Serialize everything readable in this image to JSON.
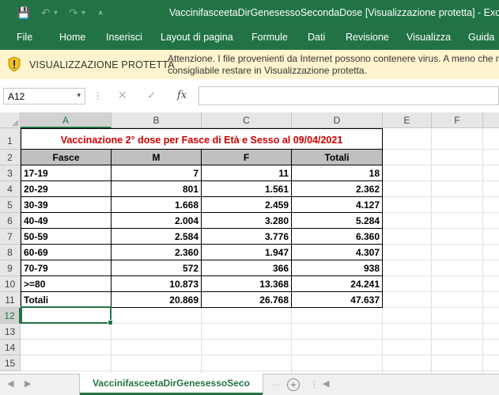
{
  "window": {
    "title": "VaccinifasceetaDirGenesessoSecondaDose  [Visualizzazione protetta]  -  Excel",
    "qat": {
      "save": "💾",
      "undo": "↶",
      "undo_dd": "▾",
      "redo": "↷",
      "redo_dd": "▾",
      "customize": "⩡"
    }
  },
  "ribbon": {
    "tabs": [
      "File",
      "Home",
      "Inserisci",
      "Layout di pagina",
      "Formule",
      "Dati",
      "Revisione",
      "Visualizza",
      "Guida"
    ]
  },
  "message_bar": {
    "title": "VISUALIZZAZIONE PROTETTA",
    "line1": "Attenzione. I file provenienti da Internet possono contenere virus. A meno che n",
    "line2": "consigliabile restare in Visualizzazione protetta.",
    "accent": "#f1c21b"
  },
  "formula_bar": {
    "name_box": "A12",
    "name_dd": "▾",
    "sep": "⋮",
    "cancel": "✕",
    "enter": "✓",
    "fx": "fx",
    "formula": ""
  },
  "sheet": {
    "columns": [
      "A",
      "B",
      "C",
      "D",
      "E",
      "F"
    ],
    "rows": [
      "1",
      "2",
      "3",
      "4",
      "5",
      "6",
      "7",
      "8",
      "9",
      "10",
      "11",
      "12",
      "13",
      "14",
      "15"
    ],
    "title": "Vaccinazione 2° dose per Fasce di Età e Sesso al 09/04/2021",
    "headers": [
      "Fasce",
      "M",
      "F",
      "Totali"
    ],
    "data": [
      [
        "17-19",
        "7",
        "11",
        "18"
      ],
      [
        "20-29",
        "801",
        "1.561",
        "2.362"
      ],
      [
        "30-39",
        "1.668",
        "2.459",
        "4.127"
      ],
      [
        "40-49",
        "2.004",
        "3.280",
        "5.284"
      ],
      [
        "50-59",
        "2.584",
        "3.776",
        "6.360"
      ],
      [
        "60-69",
        "2.360",
        "1.947",
        "4.307"
      ],
      [
        "70-79",
        "572",
        "366",
        "938"
      ],
      [
        ">=80",
        "10.873",
        "13.368",
        "24.241"
      ],
      [
        "Totali",
        "20.869",
        "26.768",
        "47.637"
      ]
    ],
    "active_cell": "A12"
  },
  "tabs_bar": {
    "prev": "◀",
    "next": "▶",
    "sheet_name": "VaccinifasceetaDirGenesessoSeco",
    "add": "+",
    "scroll_left": "◀"
  },
  "colors": {
    "excel_green": "#217346",
    "title_red": "#d00000",
    "header_fill": "#c0c0c0"
  }
}
